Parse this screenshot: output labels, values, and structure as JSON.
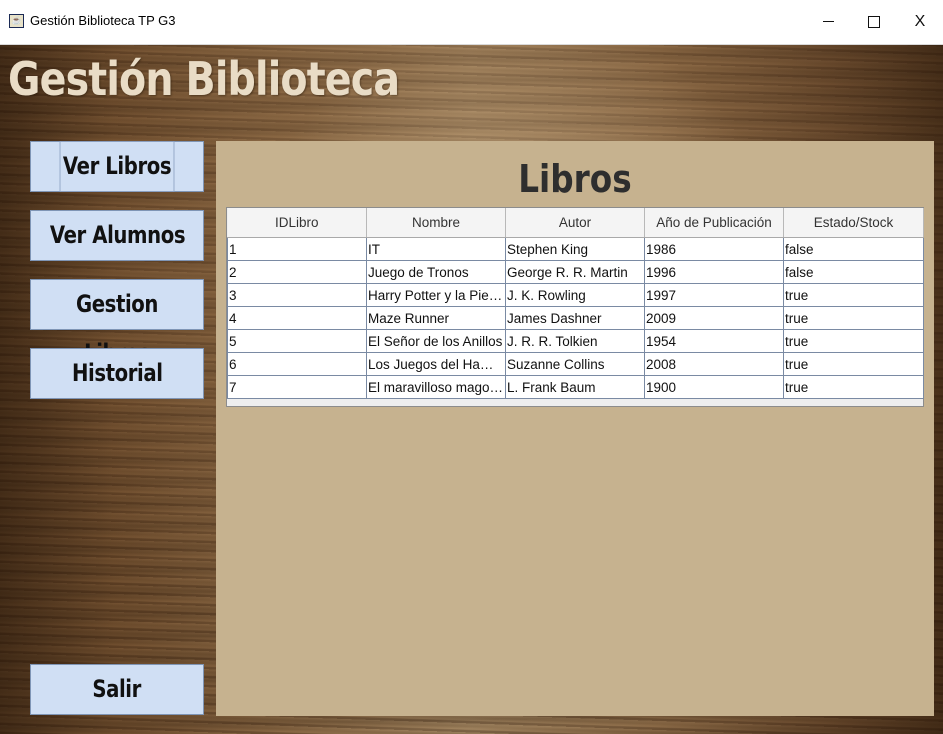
{
  "window": {
    "title": "Gestión Biblioteca TP G3",
    "icon": "java-app-icon",
    "controls": [
      "minimize",
      "maximize",
      "close"
    ],
    "close_label": "X"
  },
  "header": {
    "title": "Gestión Biblioteca"
  },
  "sidebar": {
    "items": [
      {
        "label": "Ver Libros",
        "active": true
      },
      {
        "label": "Ver Alumnos",
        "active": false
      },
      {
        "label": "Gestion Libros",
        "active": false
      },
      {
        "label": "Historial",
        "active": false
      }
    ],
    "exit_label": "Salir"
  },
  "panel": {
    "title": "Libros"
  },
  "table": {
    "columns": [
      "IDLibro",
      "Nombre",
      "Autor",
      "Año de Publicación",
      "Estado/Stock"
    ],
    "rows": [
      [
        "1",
        "IT",
        "Stephen King",
        "1986",
        "false"
      ],
      [
        "2",
        "Juego de Tronos",
        "George R. R. Martin",
        "1996",
        "false"
      ],
      [
        "3",
        "Harry Potter y la Piedra ...",
        "J. K. Rowling",
        "1997",
        "true"
      ],
      [
        "4",
        "Maze Runner",
        "James Dashner",
        "2009",
        "true"
      ],
      [
        "5",
        "El Señor de los Anillos",
        "J. R. R. Tolkien",
        "1954",
        "true"
      ],
      [
        "6",
        "Los Juegos del Hambre",
        "Suzanne Collins",
        "2008",
        "true"
      ],
      [
        "7",
        "El maravilloso mago d...",
        "L. Frank Baum",
        "1900",
        "true"
      ]
    ]
  },
  "colors": {
    "button_bg": "#d0dff4",
    "panel_bg": "#c6b28f",
    "header_text": "#e9dcc6"
  }
}
